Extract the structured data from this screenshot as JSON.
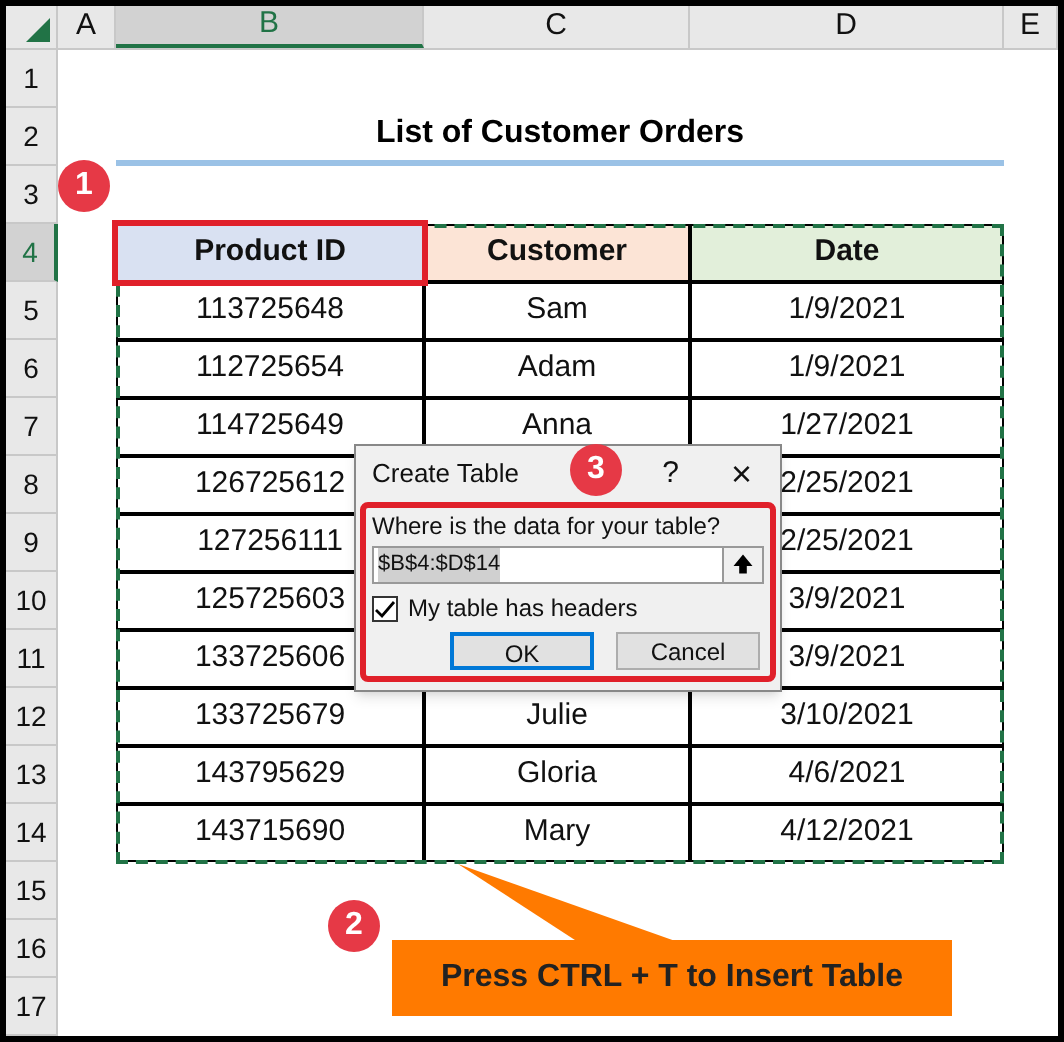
{
  "column_headers": [
    {
      "label": "A",
      "selected": false
    },
    {
      "label": "B",
      "selected": true
    },
    {
      "label": "C",
      "selected": false
    },
    {
      "label": "D",
      "selected": false
    },
    {
      "label": "E",
      "selected": false
    }
  ],
  "row_headers": [
    {
      "label": "1",
      "selected": false
    },
    {
      "label": "2",
      "selected": false
    },
    {
      "label": "3",
      "selected": false
    },
    {
      "label": "4",
      "selected": true
    },
    {
      "label": "5",
      "selected": false
    },
    {
      "label": "6",
      "selected": false
    },
    {
      "label": "7",
      "selected": false
    },
    {
      "label": "8",
      "selected": false
    },
    {
      "label": "9",
      "selected": false
    },
    {
      "label": "10",
      "selected": false
    },
    {
      "label": "11",
      "selected": false
    },
    {
      "label": "12",
      "selected": false
    },
    {
      "label": "13",
      "selected": false
    },
    {
      "label": "14",
      "selected": false
    },
    {
      "label": "15",
      "selected": false
    },
    {
      "label": "16",
      "selected": false
    },
    {
      "label": "17",
      "selected": false
    }
  ],
  "title": "List of Customer Orders",
  "table": {
    "columns": [
      {
        "label": "Product ID",
        "color": "#d9e1f2",
        "selected": true
      },
      {
        "label": "Customer",
        "color": "#fce4d6",
        "selected": false
      },
      {
        "label": "Date",
        "color": "#e2efda",
        "selected": false
      }
    ],
    "rows": [
      [
        "113725648",
        "Sam",
        "1/9/2021"
      ],
      [
        "112725654",
        "Adam",
        "1/9/2021"
      ],
      [
        "114725649",
        "Anna",
        "1/27/2021"
      ],
      [
        "126725612",
        "",
        "2/25/2021"
      ],
      [
        "127256111",
        "",
        "2/25/2021"
      ],
      [
        "125725603",
        "",
        "3/9/2021"
      ],
      [
        "133725606",
        "",
        "3/9/2021"
      ],
      [
        "133725679",
        "Julie",
        "3/10/2021"
      ],
      [
        "143795629",
        "Gloria",
        "4/6/2021"
      ],
      [
        "143715690",
        "Mary",
        "4/12/2021"
      ]
    ]
  },
  "dialog": {
    "title": "Create Table",
    "help": "?",
    "close": "×",
    "prompt": "Where is the data for your table?",
    "range": "$B$4:$D$14",
    "checkbox": {
      "label": "My table has headers",
      "checked": true
    },
    "buttons": [
      {
        "label": "OK",
        "kind": "default"
      },
      {
        "label": "Cancel",
        "kind": "normal"
      }
    ]
  },
  "steps": [
    {
      "number": "1"
    },
    {
      "number": "2"
    },
    {
      "number": "3"
    }
  ],
  "callout": "Press CTRL + T to Insert Table"
}
